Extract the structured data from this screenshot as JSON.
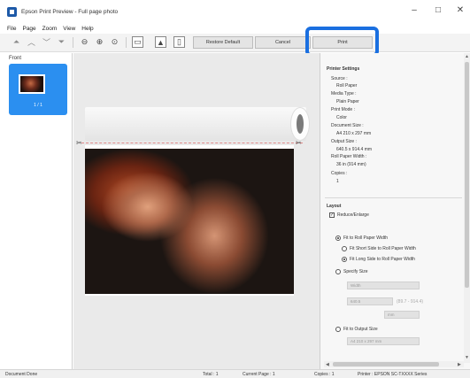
{
  "window": {
    "title": "Epson Print Preview - Full page photo",
    "controls": {
      "minimize": "–",
      "maximize": "□",
      "close": "✕"
    }
  },
  "menu": [
    "File",
    "Page",
    "Zoom",
    "View",
    "Help"
  ],
  "toolbar": {
    "restore_default": "Restore Default",
    "cancel": "Cancel",
    "print": "Print"
  },
  "thumbnails": {
    "header": "Front",
    "items": [
      {
        "label": "1 / 1"
      }
    ]
  },
  "printer_settings": {
    "heading": "Printer Settings",
    "source_label": "Source :",
    "source_value": "Roll Paper",
    "media_type_label": "Media Type :",
    "media_type_value": "Plain Paper",
    "print_mode_label": "Print Mode :",
    "print_mode_value": "Color",
    "document_size_label": "Document Size :",
    "document_size_value": "A4 210 x 297 mm",
    "output_size_label": "Output Size :",
    "output_size_value": "640.5 x 914.4 mm",
    "roll_width_label": "Roll Paper Width :",
    "roll_width_value": "36 in (914 mm)",
    "copies_label": "Copies :",
    "copies_value": "1"
  },
  "layout": {
    "heading": "Layout",
    "reduce_enlarge": "Reduce/Enlarge",
    "fit_roll_width": "Fit to Roll Paper Width",
    "fit_short_side": "Fit Short Side to Roll Paper Width",
    "fit_long_side": "Fit Long Side to Roll Paper Width",
    "specify_size": "Specify Size",
    "width_placeholder": "Width",
    "size_value": "640.5",
    "range_hint": "(89.7 - 914.4)",
    "unit": "mm",
    "fit_output_size": "Fit to Output Size",
    "output_size_field": "A4 210 x 297 mm"
  },
  "statusbar": {
    "document": "Document Done",
    "total": "Total : 1",
    "current_page": "Current Page : 1",
    "copies": "Copies : 1",
    "printer": "Printer : EPSON SC-TXXXX Series"
  }
}
